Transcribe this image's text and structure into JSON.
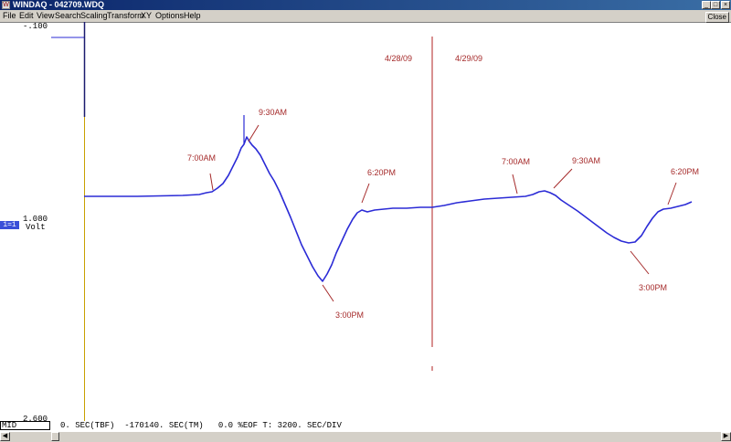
{
  "window": {
    "title": "WINDAQ - 042709.WDQ",
    "app_icon": "windaq-logo-icon"
  },
  "menu": [
    "File",
    "Edit",
    "View",
    "Search",
    "Scaling",
    "Transform",
    "XY",
    "Options",
    "Help"
  ],
  "close_button": "Close",
  "scale": {
    "top": "-.100",
    "mid_value": "1.080",
    "mid_unit": "Volt",
    "bottom": "2.600",
    "channel": "1=1"
  },
  "annotations": {
    "date_left": "4/28/09",
    "date_right": "4/29/09",
    "day1": [
      "7:00AM",
      "9:30AM",
      "3:00PM",
      "6:20PM"
    ],
    "day2": [
      "7:00AM",
      "9:30AM",
      "3:00PM",
      "6:20PM"
    ]
  },
  "status": {
    "mode": "MID",
    "text": "0. SEC(TBF)  -170140. SEC(TM)   0.0 %EOF T: 3200. SEC/DIV"
  },
  "colors": {
    "trace": "#2b2bd6",
    "annotation": "#a52a2a",
    "cursor": "#c8a000",
    "titlebar": "#0a246a"
  }
}
